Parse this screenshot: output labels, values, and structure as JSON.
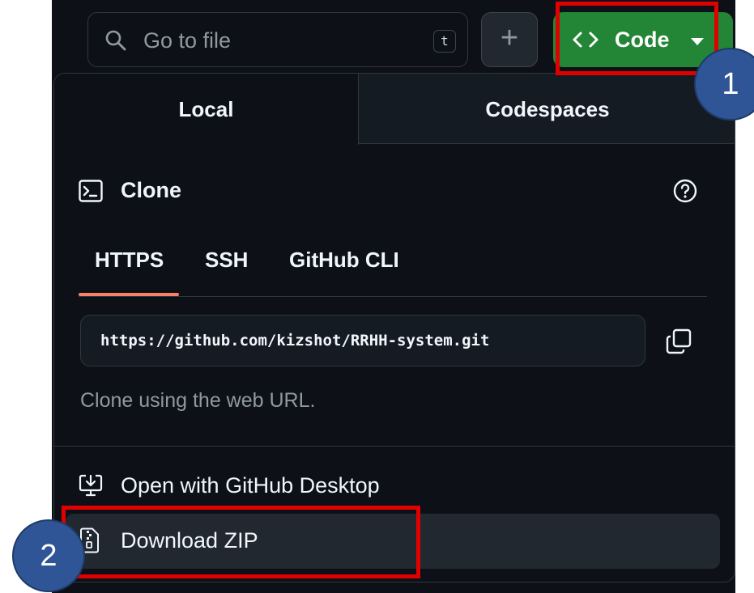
{
  "toolbar": {
    "search_placeholder": "Go to file",
    "search_shortcut": "t",
    "add_label": "+",
    "code_label": "Code"
  },
  "dropdown": {
    "tabs": [
      "Local",
      "Codespaces"
    ],
    "clone": {
      "title": "Clone",
      "protocols": [
        "HTTPS",
        "SSH",
        "GitHub CLI"
      ],
      "active_protocol": "HTTPS",
      "url": "https://github.com/kizshot/RRHH-system.git",
      "hint": "Clone using the web URL."
    },
    "menu": [
      "Open with GitHub Desktop",
      "Download ZIP"
    ]
  },
  "annotations": {
    "step1": "1",
    "step2": "2"
  },
  "colors": {
    "background": "#0d1117",
    "code_button": "#238636",
    "tab_indicator": "#f78166",
    "annotation_box": "#e00000",
    "badge": "#2f5597"
  },
  "icons": [
    "search-icon",
    "code-brackets-icon",
    "caret-down-icon",
    "terminal-icon",
    "help-icon",
    "copy-icon",
    "desktop-download-icon",
    "file-zip-icon"
  ]
}
